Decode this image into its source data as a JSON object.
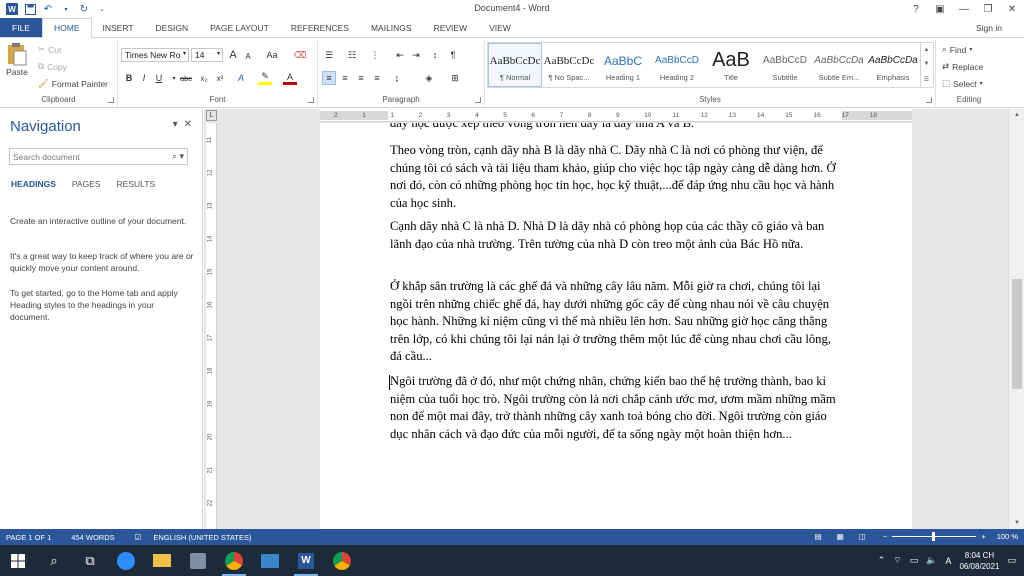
{
  "window": {
    "title": "Document4 - Word",
    "help": "?",
    "controls": [
      "▣",
      "—",
      "❐",
      "✕"
    ]
  },
  "ribbon_tabs": [
    "FILE",
    "HOME",
    "INSERT",
    "DESIGN",
    "PAGE LAYOUT",
    "REFERENCES",
    "MAILINGS",
    "REVIEW",
    "VIEW"
  ],
  "active_tab": "HOME",
  "signin": "Sign in",
  "clipboard": {
    "paste": "Paste",
    "cut": "Cut",
    "copy": "Copy",
    "format_painter": "Format Painter",
    "label": "Clipboard"
  },
  "font": {
    "name": "Times New Ro",
    "size": "14",
    "label": "Font",
    "grow": "A",
    "shrink": "A",
    "case": "Aa",
    "bold": "B",
    "italic": "I",
    "underline": "U",
    "strike": "abc",
    "sub": "x₂",
    "sup": "x²"
  },
  "paragraph": {
    "label": "Paragraph"
  },
  "styles": {
    "label": "Styles",
    "items": [
      {
        "sample": "AaBbCcDc",
        "name": "¶ Normal"
      },
      {
        "sample": "AaBbCcDc",
        "name": "¶ No Spac..."
      },
      {
        "sample": "AaBbC",
        "name": "Heading 1"
      },
      {
        "sample": "AaBbCcD",
        "name": "Heading 2"
      },
      {
        "sample": "AaB",
        "name": "Title"
      },
      {
        "sample": "AaBbCcD",
        "name": "Subtitle"
      },
      {
        "sample": "AaBbCcDa",
        "name": "Subtle Em..."
      },
      {
        "sample": "AaBbCcDa",
        "name": "Emphasis"
      }
    ]
  },
  "editing": {
    "find": "Find",
    "replace": "Replace",
    "select": "Select",
    "label": "Editing"
  },
  "nav": {
    "title": "Navigation",
    "search_placeholder": "Search document",
    "tabs": [
      "HEADINGS",
      "PAGES",
      "RESULTS"
    ],
    "help": [
      "Create an interactive outline of your document.",
      "It's a great way to keep track of where you are or quickly move your content around.",
      "To get started, go to the Home tab and apply Heading styles to the headings in your document."
    ]
  },
  "ruler": {
    "h_ticks": [
      "2",
      "1",
      "1",
      "2",
      "3",
      "4",
      "5",
      "6",
      "7",
      "8",
      "9",
      "10",
      "11",
      "12",
      "13",
      "14",
      "15",
      "16",
      "17",
      "18"
    ],
    "v_ticks": [
      "11",
      "12",
      "13",
      "14",
      "15",
      "16",
      "17",
      "18",
      "19",
      "20",
      "21",
      "22",
      "23"
    ]
  },
  "document": {
    "cut_line": "dãy học được xếp theo vòng tròn nên dãy là dãy nhà A và B.",
    "paragraphs": [
      "Theo vòng tròn, cạnh dãy nhà B là dãy nhà C. Dãy nhà C là nơi có phòng thư viện, để chúng tôi có sách và tài liệu tham khảo, giúp cho việc học tập ngày càng dễ dàng hơn. Ở nơi đó, còn có những phòng học tin học, học kỹ thuật,...để đáp ứng nhu cầu học và hành của học sinh.",
      "Cạnh dãy nhà C là nhà D. Nhà D là dãy nhà có phòng họp của các thầy cô giáo và ban lãnh đạo của nhà trường. Trên tường của nhà D còn treo một ảnh của Bác Hồ nữa.",
      "Ở khắp sân trường là các ghế đá và những cây lâu năm. Mỗi giờ ra chơi, chúng tôi lại ngồi trên những chiếc ghế đá, hay dưới những gốc cây để cùng nhau nói về câu chuyện học hành. Những kỉ niệm cũng vì thế mà nhiều lên hơn. Sau những giờ học căng thẳng trên lớp, có khi chúng tôi lại nán lại ở trường thêm một lúc để cùng nhau chơi cầu lông, đá cầu...",
      "Ngôi trường đã ở đó, như một chứng nhân, chứng kiến bao thế hệ trưởng thành, bao kỉ niệm của tuổi học trò. Ngôi trường còn là nơi chắp cánh ước mơ, ươm mầm những mầm non để một mai đây, trở thành những cây xanh toả bóng cho đời. Ngôi trường còn giáo dục nhân cách và đạo đức của mỗi người, để ta sống ngày một hoàn thiện hơn..."
    ]
  },
  "status": {
    "page": "PAGE 1 OF 1",
    "words": "454 WORDS",
    "language": "ENGLISH (UNITED STATES)",
    "zoom": "100 %",
    "zoom_percent": 100
  },
  "taskbar": {
    "time": "8:04 CH",
    "date": "06/08/2021"
  },
  "colors": {
    "accent": "#2b579a",
    "taskbar": "#1c2a3a"
  }
}
